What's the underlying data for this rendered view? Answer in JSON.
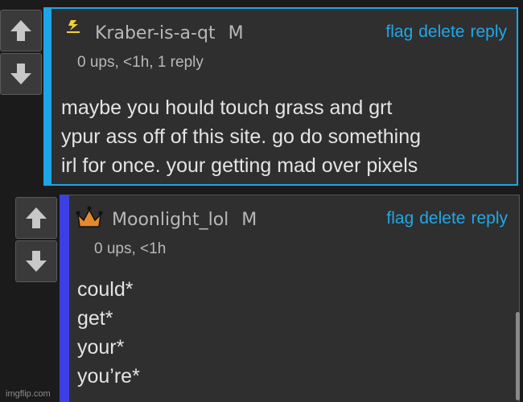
{
  "comments": [
    {
      "username": "Kraber-is-a-qt",
      "mod_badge": "M",
      "flair_icon": "lightning-icon",
      "meta": "0 ups, <1h, 1 reply",
      "actions": {
        "flag": "flag",
        "delete": "delete",
        "reply": "reply"
      },
      "body_lines": [
        "maybe you hould touch grass and grt",
        "ypur ass off of this site. go do something",
        "irl for once. your getting mad over pixels"
      ],
      "border_color": "#1ea5e6"
    },
    {
      "username": "Moonlight_lol",
      "mod_badge": "M",
      "flair_icon": "crown-icon",
      "meta": "0 ups, <1h",
      "actions": {
        "flag": "flag",
        "delete": "delete",
        "reply": "reply"
      },
      "body_lines": [
        "could*",
        "get*",
        "your*",
        "you’re*"
      ],
      "border_color": "#3d3ee4"
    }
  ],
  "icons": {
    "upvote": "up-arrow-icon",
    "downvote": "down-arrow-icon"
  },
  "watermark": "imgflip.com",
  "colors": {
    "link": "#20a8e6",
    "background": "#1b1b1c",
    "panel": "#2f2f30"
  }
}
